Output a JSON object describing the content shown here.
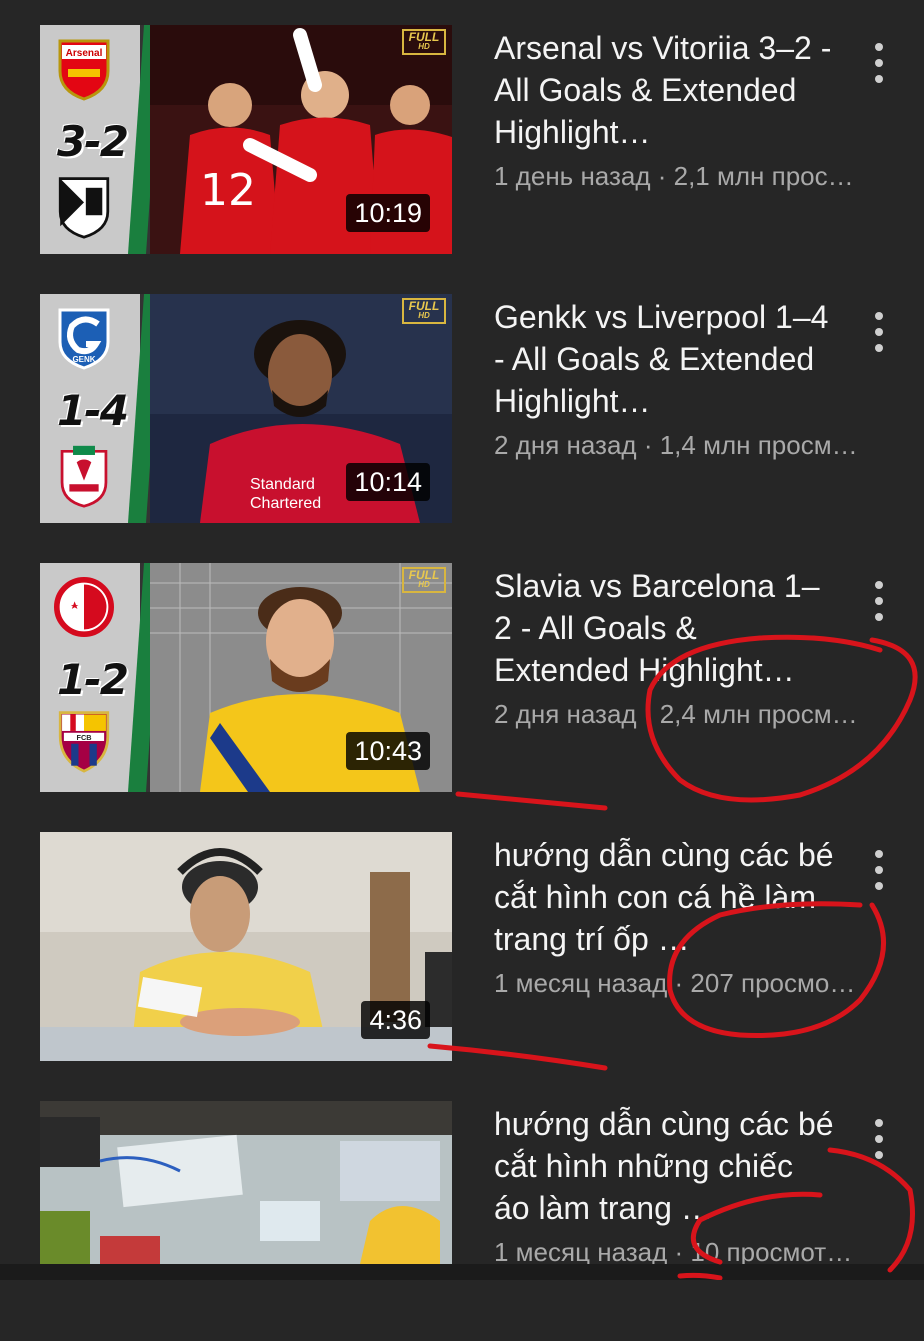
{
  "videos": [
    {
      "title": "Arsenal vs Vitoriia 3–2 - All Goals & Extended Highlight…",
      "meta": "1 день назад · 2,1 млн прос…",
      "duration": "10:19",
      "score": "3-2",
      "badge_top": "FULL",
      "badge_bottom": "HD",
      "home_logo_text": "Arsenal"
    },
    {
      "title": "Genkk vs Liverpool 1–4 - All Goals & Extended Highlight…",
      "meta": "2 дня назад · 1,4 млн просм…",
      "duration": "10:14",
      "score": "1-4",
      "badge_top": "FULL",
      "badge_bottom": "HD",
      "home_logo_text": "GENK",
      "shirt_text": "Standard Chartered"
    },
    {
      "title": "Slavia vs Barcelona 1–2 - All Goals & Extended Highlight…",
      "meta": "2 дня назад · 2,4 млн просм…",
      "duration": "10:43",
      "score": "1-2",
      "badge_top": "FULL",
      "badge_bottom": "HD",
      "away_logo_text": "FCB"
    },
    {
      "title": "hướng dẫn cùng các bé  cắt hình con cá hề làm trang trí ốp …",
      "meta": "1 месяц назад · 207 просмо…",
      "duration": "4:36"
    },
    {
      "title": "hướng dẫn cùng các bé  cắt hình những chiếc áo làm trang …",
      "meta": "1 месяц назад · 10 просмот…"
    }
  ],
  "colors": {
    "background": "#262626",
    "annotation": "#d8141b",
    "title_text": "#f4f4f4",
    "meta_text": "#a9a9a9"
  }
}
